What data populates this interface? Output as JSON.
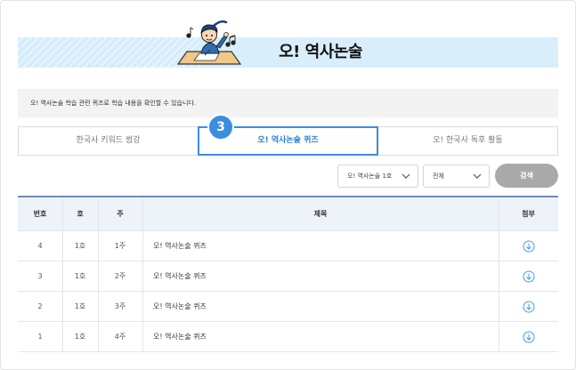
{
  "banner": {
    "title": "오! 역사논술"
  },
  "info": {
    "text": "오! 역사논술 학습 관련 퀴즈로 학습 내용을 확인할 수 있습니다."
  },
  "tabs": [
    {
      "label": "한국사 키워드 썸강"
    },
    {
      "label": "오! 역사논술 퀴즈"
    },
    {
      "label": "오! 한국사 독후 활동"
    }
  ],
  "step_badge": "3",
  "filters": {
    "issue_select": "오! 역사논술 1호",
    "scope_select": "전체",
    "search_label": "검색"
  },
  "table": {
    "headers": {
      "number": "번호",
      "issue": "호",
      "week": "주",
      "title": "제목",
      "attachment": "첨부"
    },
    "rows": [
      {
        "number": "4",
        "issue": "1호",
        "week": "1주",
        "title": "오! 역사논술 퀴즈"
      },
      {
        "number": "3",
        "issue": "1호",
        "week": "2주",
        "title": "오! 역사논술 퀴즈"
      },
      {
        "number": "2",
        "issue": "1호",
        "week": "3주",
        "title": "오! 역사논술 퀴즈"
      },
      {
        "number": "1",
        "issue": "1호",
        "week": "4주",
        "title": "오! 역사논술 퀴즈"
      }
    ]
  },
  "colors": {
    "accent": "#3a8ee0",
    "banner_bg": "#d8eefb",
    "search_button": "#a9a9a9",
    "table_header_bg": "#eef3f9"
  },
  "icons": {
    "mascot": "student-writing-with-music-notes",
    "select_arrow": "chevron-down-icon",
    "attachment": "download-circle-icon"
  }
}
